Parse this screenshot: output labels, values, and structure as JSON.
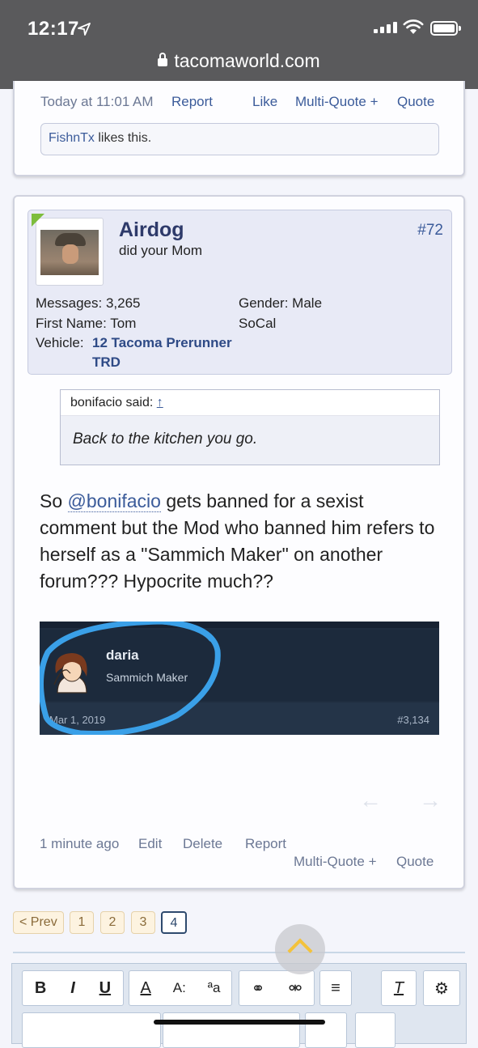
{
  "status_bar": {
    "time": "12:17",
    "url": "tacomaworld.com"
  },
  "prev_post": {
    "timestamp": "Today at 11:01 AM",
    "report": "Report",
    "like": "Like",
    "multi_quote": "Multi-Quote +",
    "quote": "Quote",
    "likes_user": "FishnTx",
    "likes_text": "likes this."
  },
  "post": {
    "number": "#72",
    "username": "Airdog",
    "user_title": "did your Mom",
    "messages_label": "Messages:",
    "messages_value": "3,265",
    "first_name_label": "First Name:",
    "first_name_value": "Tom",
    "vehicle_label": "Vehicle:",
    "vehicle_value_line1": "12 Tacoma Prerunner",
    "vehicle_value_line2": "TRD",
    "gender_label": "Gender:",
    "gender_value": "Male",
    "location": "SoCal",
    "quote_author": "bonifacio said:",
    "quote_arrow": "↑",
    "quote_text": "Back to the kitchen you go.",
    "message_prefix": "So",
    "mention": "@bonifacio",
    "message_rest": " gets banned for a sexist comment but the Mod who banned him refers to herself as a \"Sammich Maker\" on another forum??? Hypocrite much??",
    "embedded": {
      "name": "daria",
      "title": "Sammich Maker",
      "date": "Mar 1, 2019",
      "post_number": "#3,134"
    },
    "time_ago": "1 minute ago",
    "edit": "Edit",
    "delete": "Delete",
    "report": "Report",
    "multi_quote": "Multi-Quote +",
    "quote": "Quote"
  },
  "pagination": {
    "prev": "< Prev",
    "pages": [
      "1",
      "2",
      "3",
      "4"
    ],
    "current": "4"
  },
  "editor": {
    "bold": "B",
    "italic": "I",
    "underline": "U",
    "font_color": "A",
    "font_size": "A:",
    "font_family": "ªa"
  },
  "colors": {
    "accent": "#3b5b9a",
    "username": "#2e3a6a",
    "highlight_circle": "#3aa0e8"
  }
}
